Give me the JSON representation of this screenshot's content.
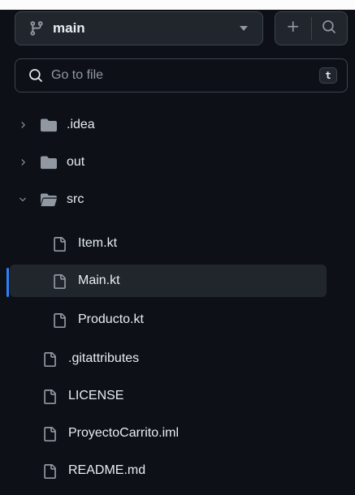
{
  "branch": {
    "name": "main"
  },
  "search": {
    "placeholder": "Go to file",
    "shortcut": "t"
  },
  "tree": [
    {
      "label": ".idea",
      "type": "folder",
      "state": "collapsed",
      "depth": 0
    },
    {
      "label": "out",
      "type": "folder",
      "state": "collapsed",
      "depth": 0
    },
    {
      "label": "src",
      "type": "folder",
      "state": "expanded",
      "depth": 0
    },
    {
      "label": "Item.kt",
      "type": "file",
      "depth": 1
    },
    {
      "label": "Main.kt",
      "type": "file",
      "depth": 1,
      "selected": true
    },
    {
      "label": "Producto.kt",
      "type": "file",
      "depth": 1
    },
    {
      "label": ".gitattributes",
      "type": "file",
      "depth": 0
    },
    {
      "label": "LICENSE",
      "type": "file",
      "depth": 0
    },
    {
      "label": "ProyectoCarrito.iml",
      "type": "file",
      "depth": 0
    },
    {
      "label": "README.md",
      "type": "file",
      "depth": 0
    }
  ],
  "colors": {
    "background": "#0d1117",
    "button": "#21262d",
    "border": "#3d444d",
    "muted": "#9198a1",
    "text": "#e6edf3",
    "accent": "#2f81f7"
  }
}
